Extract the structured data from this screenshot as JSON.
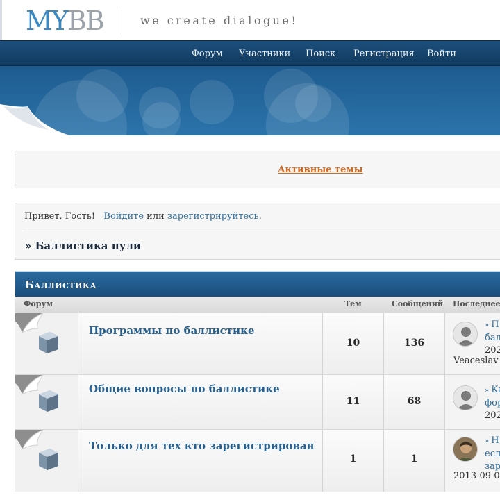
{
  "header": {
    "logo_my": "MY",
    "logo_bb": "BB",
    "tagline": "we create dialogue!"
  },
  "nav": {
    "forum": "Форум",
    "members": "Участники",
    "search": "Поиск",
    "register": "Регистрация",
    "login": "Войти"
  },
  "active_topics": {
    "label": "Активные темы"
  },
  "welcome": {
    "greeting": "Привет, Гость!",
    "login_link": "Войдите",
    "or": "или",
    "register_link": "зарегистрируйтесь",
    "period": "."
  },
  "breadcrumb": {
    "prefix": "»",
    "current": "Баллистика пули"
  },
  "category": {
    "title": "Баллистика",
    "columns": {
      "forum": "Форум",
      "topics": "Тем",
      "posts": "Сообщений",
      "last": "Последнее"
    },
    "rows": [
      {
        "name": "Программы по баллистике",
        "topics": "10",
        "posts": "136",
        "last_line1": "П",
        "last_line2": "бал",
        "last_line3": "202",
        "last_author": "Veaceslav"
      },
      {
        "name": "Общие вопросы по баллистике",
        "topics": "11",
        "posts": "68",
        "last_line1": "Ка",
        "last_line2": "фор",
        "last_line3": "202"
      },
      {
        "name": "Только для тех кто зарегистрирован",
        "topics": "1",
        "posts": "1",
        "last_line1": "Н",
        "last_line2": "есл",
        "last_line3": "зар",
        "last_author": "2013-09-0"
      }
    ]
  },
  "colors": {
    "nav_bg": "#1d4f7c",
    "banner_bg": "#2b74ab",
    "link": "#2e6d9d",
    "active_link": "#d5681e",
    "forum_link": "#28618f"
  }
}
